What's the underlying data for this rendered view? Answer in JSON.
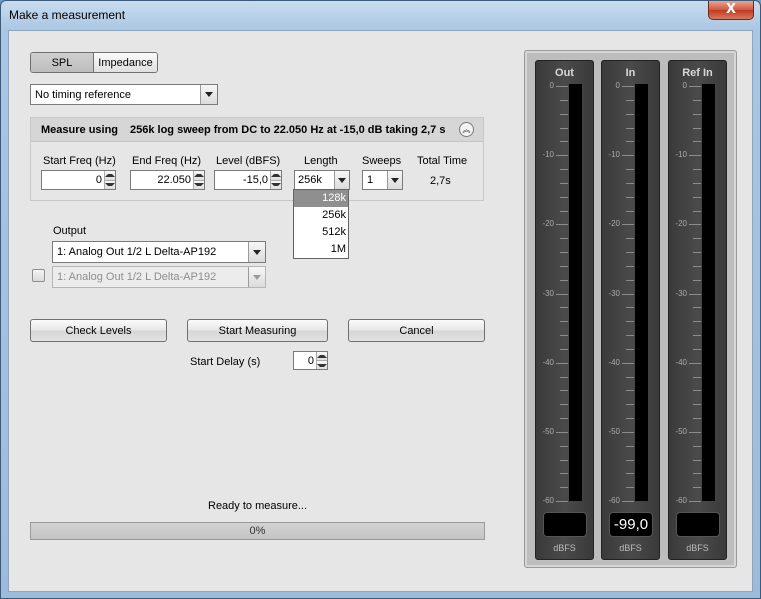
{
  "window": {
    "title": "Make a measurement",
    "close_label": "X"
  },
  "mode_tabs": [
    {
      "label": "SPL",
      "selected": true
    },
    {
      "label": "Impedance",
      "selected": false
    }
  ],
  "timing_reference": {
    "value": "No timing reference"
  },
  "measure_panel": {
    "prefix": "Measure using",
    "summary": "256k log sweep from DC to 22.050 Hz at -15,0 dB taking 2,7 s",
    "start_freq": {
      "label": "Start Freq (Hz)",
      "value": "0"
    },
    "end_freq": {
      "label": "End Freq (Hz)",
      "value": "22.050"
    },
    "level": {
      "label": "Level (dBFS)",
      "value": "-15,0"
    },
    "length": {
      "label": "Length",
      "value": "256k",
      "options": [
        "128k",
        "256k",
        "512k",
        "1M"
      ],
      "highlighted": "128k"
    },
    "sweeps": {
      "label": "Sweeps",
      "value": "1"
    },
    "total_time": {
      "label": "Total Time",
      "value": "2,7s"
    }
  },
  "output": {
    "label": "Output",
    "primary": "1: Analog Out 1/2 L Delta-AP192",
    "secondary": "1: Analog Out 1/2 L Delta-AP192",
    "secondary_enabled": false
  },
  "buttons": {
    "check_levels": "Check Levels",
    "start_measuring": "Start Measuring",
    "cancel": "Cancel"
  },
  "start_delay": {
    "label": "Start Delay (s)",
    "value": "0"
  },
  "status": {
    "text": "Ready to measure...",
    "progress_label": "0%",
    "progress": 0
  },
  "meters": [
    {
      "title": "Out",
      "readout": "",
      "unit": "dBFS"
    },
    {
      "title": "In",
      "readout": "-99,0",
      "unit": "dBFS"
    },
    {
      "title": "Ref In",
      "readout": "",
      "unit": "dBFS"
    }
  ],
  "meter_scale": [
    "0",
    "-10",
    "-20",
    "-30",
    "-40",
    "-50",
    "-60"
  ]
}
